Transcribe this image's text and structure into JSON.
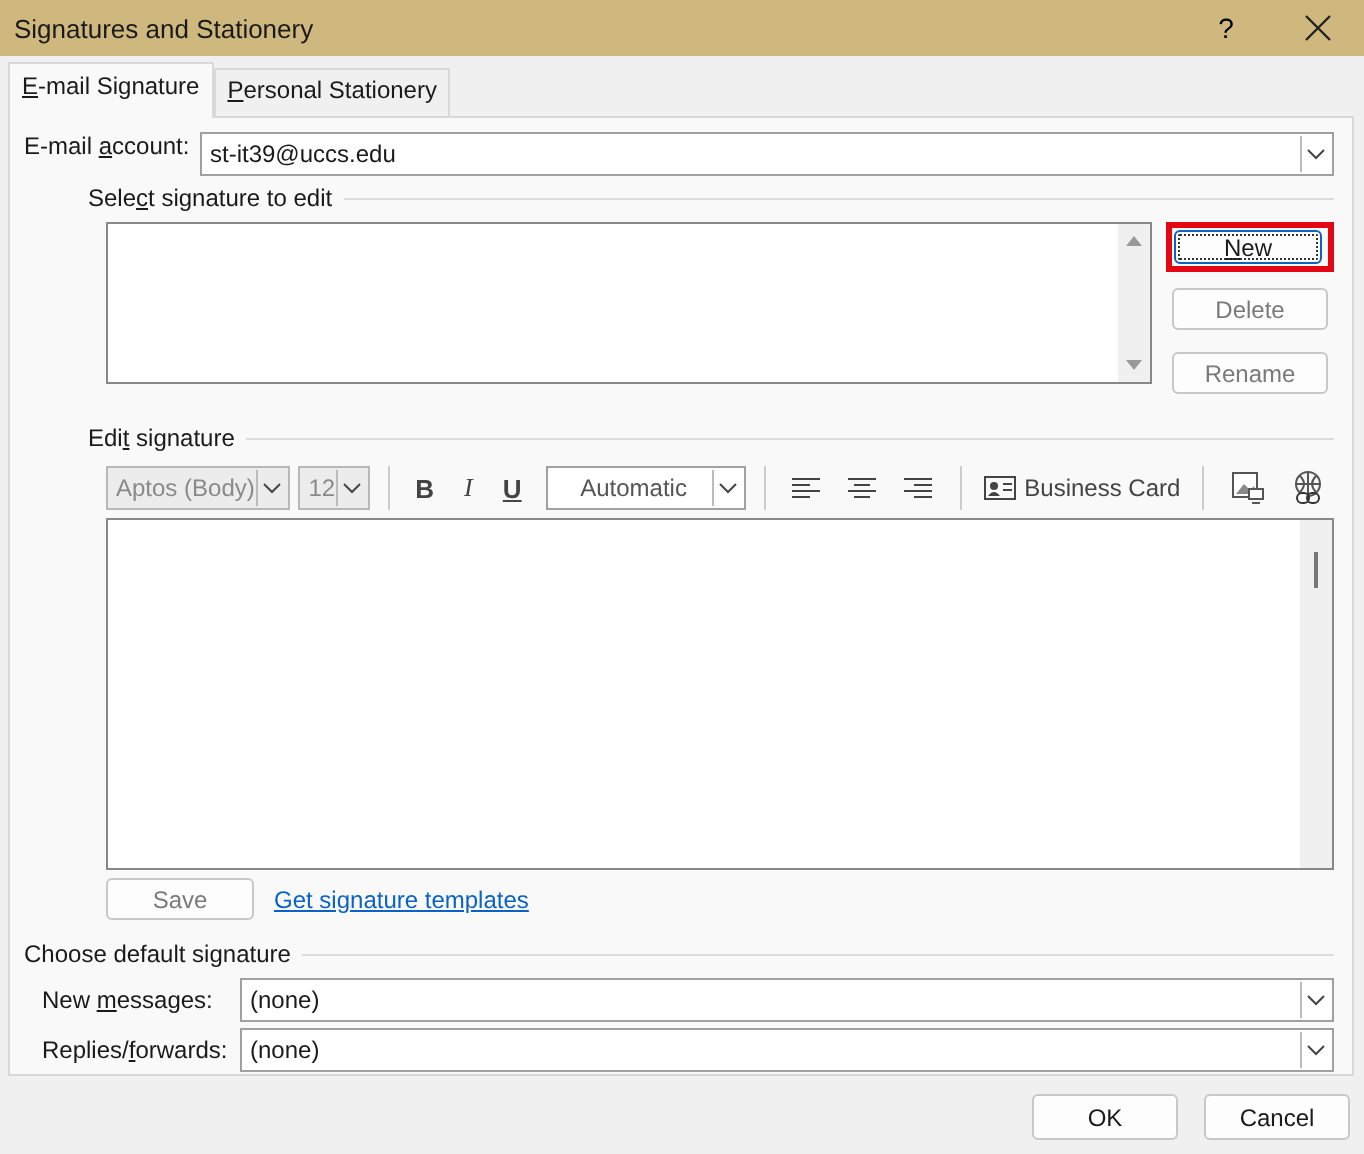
{
  "window": {
    "title": "Signatures and Stationery",
    "help": "?"
  },
  "tabs": [
    {
      "label": [
        {
          "t": "E",
          "key": true
        },
        {
          "t": "-mail Signature",
          "key": false
        }
      ],
      "selected": true
    },
    {
      "label": [
        {
          "t": "P",
          "key": true
        },
        {
          "t": "ersonal Stationery",
          "key": false
        }
      ],
      "selected": false
    }
  ],
  "email_account": {
    "label": [
      {
        "t": "E-mail ",
        "key": false
      },
      {
        "t": "a",
        "key": true
      },
      {
        "t": "ccount:",
        "key": false
      }
    ],
    "value": "st-it39@uccs.edu"
  },
  "select_signature": {
    "title": [
      {
        "t": "Sele",
        "key": false
      },
      {
        "t": "c",
        "key": true
      },
      {
        "t": "t signature to edit",
        "key": false
      }
    ],
    "buttons": [
      {
        "label": [
          {
            "t": "N",
            "key": true
          },
          {
            "t": "ew",
            "key": false
          }
        ],
        "disabled": false,
        "highlighted": true
      },
      {
        "label": [
          {
            "t": "Delete",
            "key": false
          }
        ],
        "disabled": true,
        "highlighted": false
      },
      {
        "label": [
          {
            "t": "Rename",
            "key": false
          }
        ],
        "disabled": true,
        "highlighted": false
      }
    ]
  },
  "edit_signature": {
    "title": [
      {
        "t": "Edi",
        "key": false
      },
      {
        "t": "t",
        "key": true
      },
      {
        "t": " signature",
        "key": false
      }
    ],
    "font": {
      "value": "Aptos (Body)",
      "disabled": true
    },
    "size": {
      "value": "12",
      "disabled": true
    },
    "format_buttons": [
      {
        "kind": "bold",
        "label": "B"
      },
      {
        "kind": "italic",
        "label": "I"
      },
      {
        "kind": "underline",
        "label": "U"
      }
    ],
    "color": {
      "value": "Automatic"
    },
    "business_card": "Business Card",
    "save": {
      "label": "Save",
      "disabled": true
    },
    "link": "Get signature templates"
  },
  "default_signature": {
    "title": "Choose default signature",
    "rows": [
      {
        "label": [
          {
            "t": "New ",
            "key": false
          },
          {
            "t": "m",
            "key": true
          },
          {
            "t": "essages:",
            "key": false
          }
        ],
        "value": "(none)"
      },
      {
        "label": [
          {
            "t": "Replies/",
            "key": false
          },
          {
            "t": "f",
            "key": true
          },
          {
            "t": "orwards:",
            "key": false
          }
        ],
        "value": "(none)"
      }
    ]
  },
  "footer_buttons": [
    "OK",
    "Cancel"
  ]
}
